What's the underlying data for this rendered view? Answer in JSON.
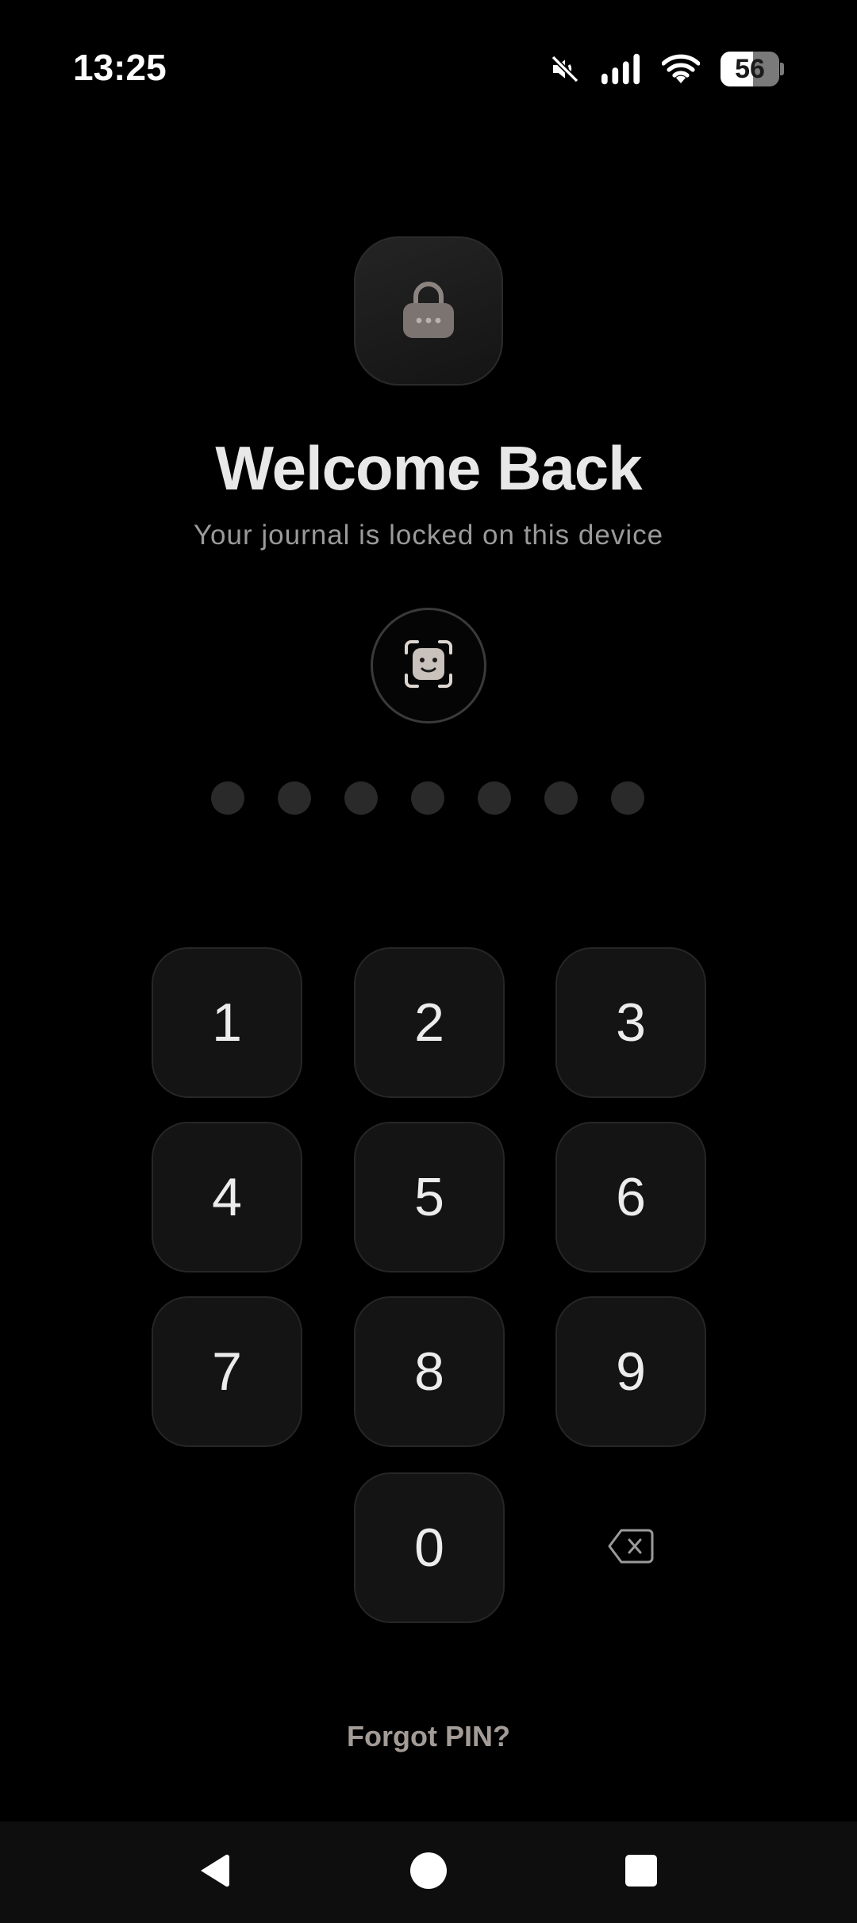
{
  "status_bar": {
    "time": "13:25",
    "battery_level": "56",
    "battery_fraction": 0.56,
    "icons": [
      "mute-icon",
      "signal-icon",
      "wifi-icon",
      "battery-icon"
    ]
  },
  "lock_screen": {
    "badge_icon": "padlock-icon",
    "title": "Welcome Back",
    "subtitle": "Your journal is locked on this device",
    "biometric_icon": "face-id-icon",
    "pin_length": 7,
    "pin_entered": 0
  },
  "keypad": {
    "keys": [
      "1",
      "2",
      "3",
      "4",
      "5",
      "6",
      "7",
      "8",
      "9",
      "0"
    ],
    "backspace_icon": "backspace-icon"
  },
  "forgot_label": "Forgot PIN?",
  "nav_bar": {
    "icons": [
      "back-triangle-icon",
      "home-circle-icon",
      "recents-square-icon"
    ]
  },
  "colors": {
    "background": "#000000",
    "key_background": "#141414",
    "dot_empty": "#2a2a2a",
    "accent_muted": "#a39b96"
  }
}
